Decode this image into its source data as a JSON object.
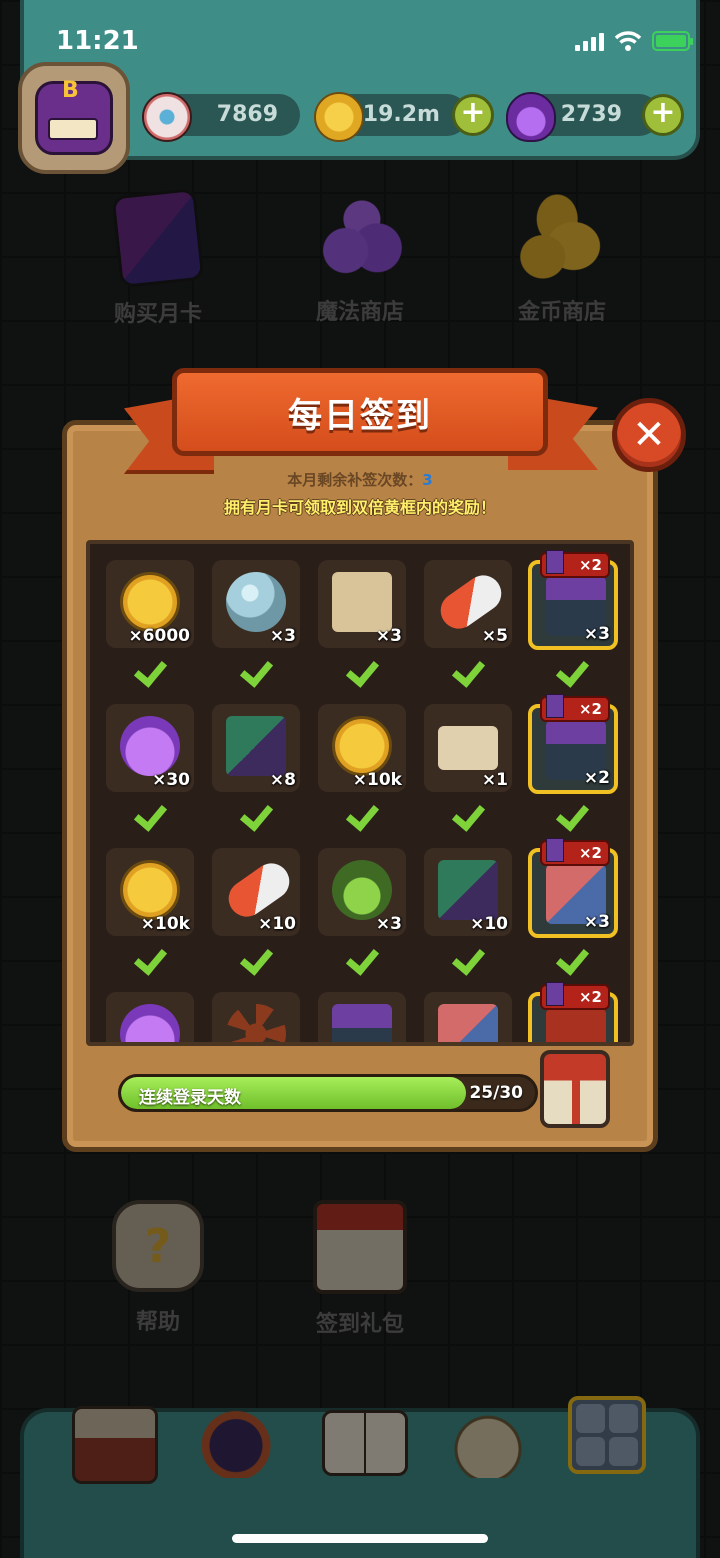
{
  "status_bar": {
    "time": "11:21"
  },
  "header": {
    "avatar_icon": "monster-avatar",
    "currencies": [
      {
        "icon": "eye-icon",
        "value": "7869"
      },
      {
        "icon": "coin-icon",
        "value": "19.2m"
      },
      {
        "icon": "potion-icon",
        "value": "2739"
      }
    ]
  },
  "shortcuts": [
    {
      "label": "购买月卡",
      "icon": "monthly-card-icon"
    },
    {
      "label": "魔法商店",
      "icon": "magic-shop-icon"
    },
    {
      "label": "金币商店",
      "icon": "coin-shop-icon"
    },
    {
      "label": "帮助",
      "icon": "help-icon"
    },
    {
      "label": "签到礼包",
      "icon": "gift-pack-icon"
    }
  ],
  "modal": {
    "title": "每日签到",
    "remaining_label": "本月剩余补签次数：",
    "remaining_count": "3",
    "tip": "拥有月卡可领取到双倍黄框内的奖励！",
    "double_tag": "×2",
    "rewards": [
      [
        {
          "icon": "coin",
          "qty": "×6000",
          "claimed": true,
          "double": false
        },
        {
          "icon": "orb",
          "qty": "×3",
          "claimed": true,
          "double": false
        },
        {
          "icon": "map",
          "qty": "×3",
          "claimed": true,
          "double": false
        },
        {
          "icon": "pill",
          "qty": "×5",
          "claimed": true,
          "double": false
        },
        {
          "icon": "box",
          "qty": "×3",
          "claimed": true,
          "double": true
        }
      ],
      [
        {
          "icon": "potion",
          "qty": "×30",
          "claimed": true,
          "double": false
        },
        {
          "icon": "card",
          "qty": "×8",
          "claimed": true,
          "double": false
        },
        {
          "icon": "coin",
          "qty": "×10k",
          "claimed": true,
          "double": false
        },
        {
          "icon": "ticket",
          "qty": "×1",
          "claimed": true,
          "double": false
        },
        {
          "icon": "box",
          "qty": "×2",
          "claimed": true,
          "double": true
        }
      ],
      [
        {
          "icon": "coin",
          "qty": "×10k",
          "claimed": true,
          "double": false
        },
        {
          "icon": "pill",
          "qty": "×10",
          "claimed": true,
          "double": false
        },
        {
          "icon": "bomb",
          "qty": "×3",
          "claimed": true,
          "double": false
        },
        {
          "icon": "card",
          "qty": "×10",
          "claimed": true,
          "double": false
        },
        {
          "icon": "book",
          "qty": "×3",
          "claimed": true,
          "double": true
        }
      ],
      [
        {
          "icon": "potion",
          "qty": "",
          "claimed": false,
          "double": false
        },
        {
          "icon": "plant",
          "qty": "",
          "claimed": false,
          "double": false
        },
        {
          "icon": "box",
          "qty": "",
          "claimed": false,
          "double": false
        },
        {
          "icon": "book",
          "qty": "",
          "claimed": false,
          "double": false
        },
        {
          "icon": "tower",
          "qty": "",
          "claimed": false,
          "double": true
        }
      ]
    ],
    "progress": {
      "label": "连续登录天数",
      "current": 25,
      "total": 30,
      "text": "25/30"
    }
  },
  "bottom_nav": [
    {
      "icon": "shop-icon"
    },
    {
      "icon": "monster-icon"
    },
    {
      "icon": "book-icon"
    },
    {
      "icon": "bag-icon"
    },
    {
      "icon": "grid-menu-icon",
      "active": true
    }
  ],
  "colors": {
    "header_teal": "#3f8d87",
    "banner_orange": "#d44d1c",
    "panel_wood": "#b88347",
    "check_green": "#7fd33a",
    "gold_frame": "#f1c022"
  }
}
